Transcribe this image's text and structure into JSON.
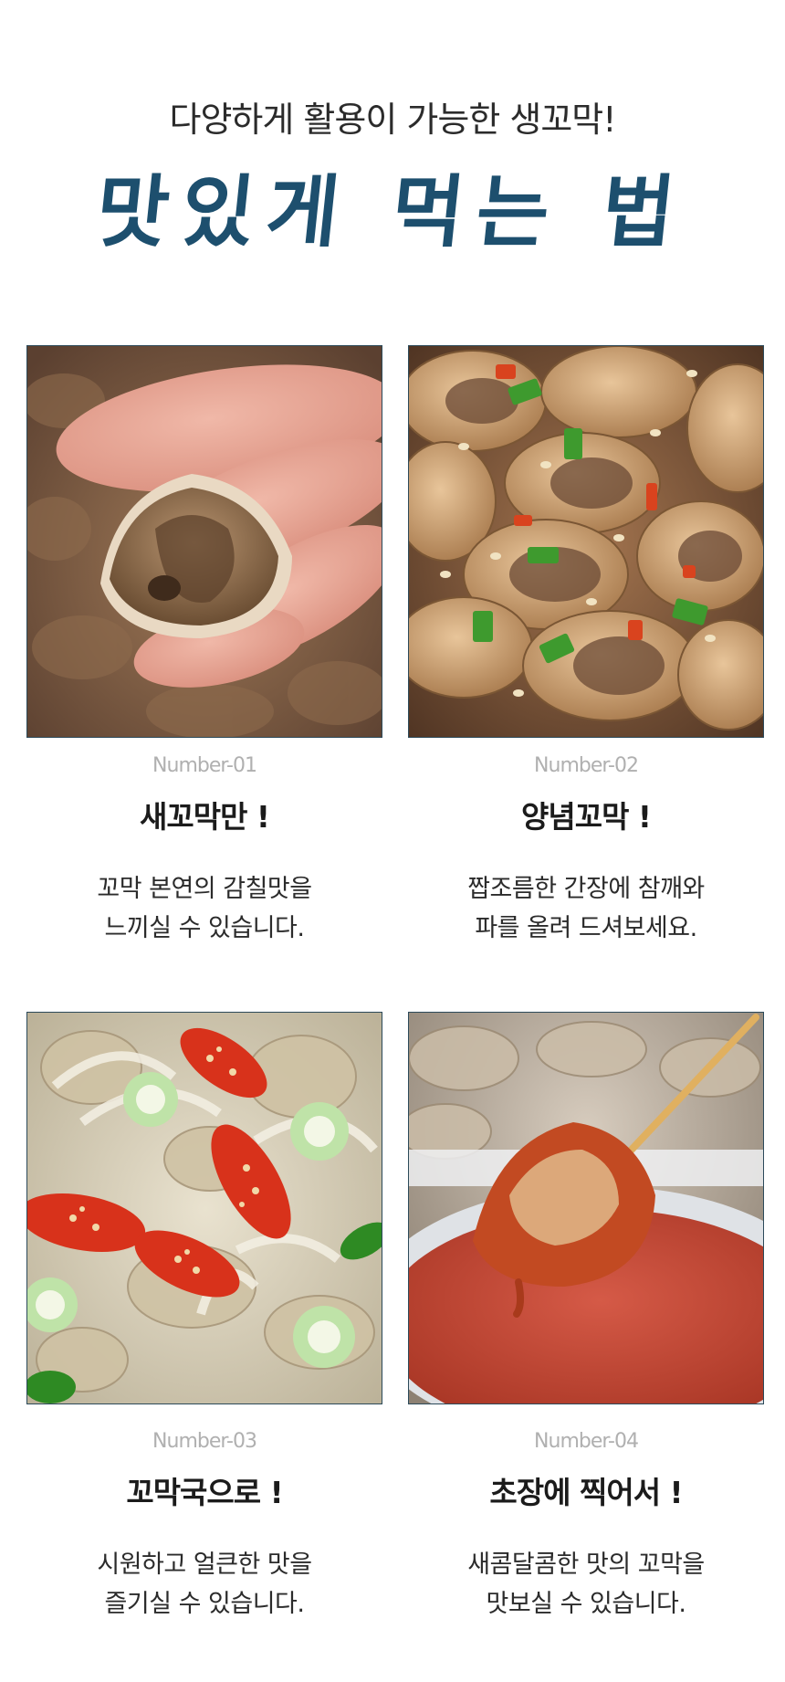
{
  "header": {
    "subtitle": "다양하게 활용이 가능한 생꼬막!",
    "title": "맛있게 먹는 법"
  },
  "items": [
    {
      "number": "Number-01",
      "heading": "새꼬막만 !",
      "lines": [
        "꼬막 본연의 감칠맛을",
        "느끼실 수 있습니다."
      ],
      "photo": "hand-holding-cockle"
    },
    {
      "number": "Number-02",
      "heading": "양념꼬막 !",
      "lines": [
        "짭조름한 간장에 참깨와",
        "파를 올려 드셔보세요."
      ],
      "photo": "seasoned-cockles"
    },
    {
      "number": "Number-03",
      "heading": "꼬막국으로 !",
      "lines": [
        "시원하고 얼큰한 맛을",
        "즐기실 수 있습니다."
      ],
      "photo": "cockle-soup"
    },
    {
      "number": "Number-04",
      "heading": "초장에 찍어서 !",
      "lines": [
        "새콤달콤한 맛의 꼬막을",
        "맛보실 수 있습니다."
      ],
      "photo": "cockle-dipped-in-chojang"
    }
  ],
  "colors": {
    "title": "#1d4f6e",
    "number": "#b0b0b0",
    "photo_border": "#2c4a5a"
  }
}
